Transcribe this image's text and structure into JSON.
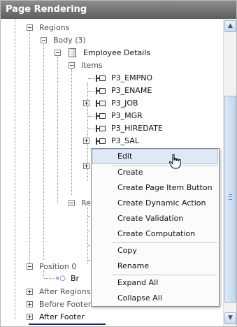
{
  "panel": {
    "title": "Page Rendering"
  },
  "tree": {
    "regions": "Regions",
    "body": "Body (3)",
    "employee_details": "Employee Details",
    "items": "Items",
    "item_list": [
      "P3_EMPNO",
      "P3_ENAME",
      "P3_JOB",
      "P3_MGR",
      "P3_HIREDATE",
      "P3_SAL"
    ],
    "re_partial": "Re",
    "position_partial": "Position 0",
    "br_partial": "Br",
    "after_regions": "After Regions",
    "before_footer": "Before Footer",
    "after_footer": "After Footer"
  },
  "context_menu": {
    "items": [
      "Edit",
      "Create",
      "Create Page Item Button",
      "Create Dynamic Action",
      "Create Validation",
      "Create Computation",
      "Copy",
      "Rename",
      "Expand All",
      "Collapse All"
    ],
    "hovered": "Edit"
  },
  "scrollbar": {
    "up_arrow": "▲",
    "down_arrow": "▼"
  },
  "icons": {
    "toggle_expanded": "minus-box-icon",
    "toggle_collapsed": "plus-box-icon",
    "page_item": "page-item-icon",
    "region": "region-page-icon",
    "branch": "branch-arrow-icon",
    "cursor": "hand-pointer-icon"
  }
}
